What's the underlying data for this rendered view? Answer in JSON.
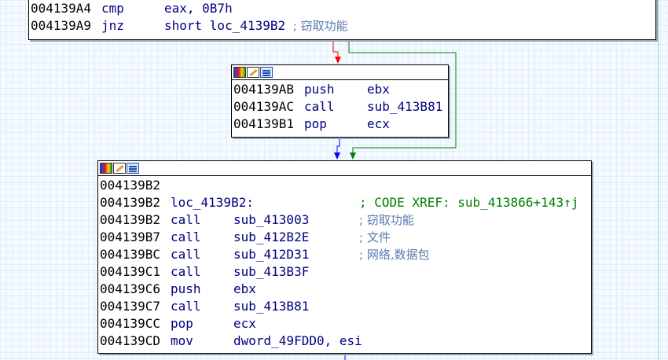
{
  "colors": {
    "background": "#f4faff",
    "node_border": "#000000",
    "address": "#000000",
    "mnemonic": "#000080",
    "comment": "#0000ff",
    "xref": "#008000",
    "edge_true": "#008000",
    "edge_false": "#ff0000",
    "edge_normal": "#0000ff"
  },
  "icons": [
    "color-icon",
    "edit-icon",
    "graph-icon"
  ],
  "top_node": {
    "rows": [
      {
        "addr": "004139A4",
        "mn": "cmp",
        "op": "eax, 0B7h",
        "cmt": ""
      },
      {
        "addr": "004139A9",
        "mn": "jnz",
        "op": "short loc_4139B2",
        "cmt": "; 窃取功能"
      }
    ]
  },
  "mid_node": {
    "rows": [
      {
        "addr": "004139AB",
        "mn": "push",
        "op": "ebx"
      },
      {
        "addr": "004139AC",
        "mn": "call",
        "op": "sub_413B81"
      },
      {
        "addr": "004139B1",
        "mn": "pop",
        "op": "ecx"
      }
    ]
  },
  "bottom_node": {
    "rows": [
      {
        "addr": "004139B2",
        "mn": "",
        "op": "",
        "cmt": ""
      },
      {
        "addr": "004139B2",
        "mn": "loc_4139B2:",
        "op": "",
        "cmt": "; CODE XREF: sub_413866+143↑j"
      },
      {
        "addr": "004139B2",
        "mn": "call",
        "op": "sub_413003",
        "cmt": "; 窃取功能"
      },
      {
        "addr": "004139B7",
        "mn": "call",
        "op": "sub_412B2E",
        "cmt": "; 文件"
      },
      {
        "addr": "004139BC",
        "mn": "call",
        "op": "sub_412D31",
        "cmt": "; 网络,数据包"
      },
      {
        "addr": "004139C1",
        "mn": "call",
        "op": "sub_413B3F",
        "cmt": ""
      },
      {
        "addr": "004139C6",
        "mn": "push",
        "op": "ebx",
        "cmt": ""
      },
      {
        "addr": "004139C7",
        "mn": "call",
        "op": "sub_413B81",
        "cmt": ""
      },
      {
        "addr": "004139CC",
        "mn": "pop",
        "op": "ecx",
        "cmt": ""
      },
      {
        "addr": "004139CD",
        "mn": "mov",
        "op": "dword_49FDD0, esi",
        "cmt": ""
      }
    ]
  }
}
